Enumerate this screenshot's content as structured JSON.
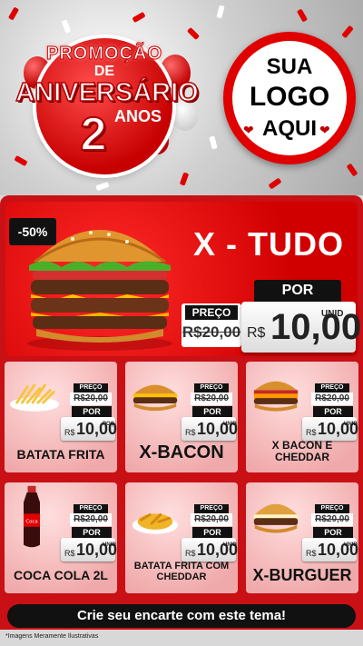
{
  "header": {
    "promo_line1": "PROMOÇÃO",
    "promo_line2": "DE",
    "promo_line3": "ANIVERSÁRIO",
    "promo_number": "2",
    "promo_anos": "ANOS",
    "logo_line1": "SUA",
    "logo_line2": "LOGO",
    "logo_line3": "AQUI"
  },
  "hero": {
    "discount": "-50%",
    "title": "X - TUDO",
    "preco_label": "PREÇO",
    "old_price": "R$20,00",
    "por_label": "POR",
    "currency": "R$",
    "new_price": "10,00",
    "unit": "UNID"
  },
  "products": [
    {
      "name": "BATATA FRITA",
      "preco_label": "PREÇO",
      "old_price": "R$20,00",
      "por_label": "POR",
      "currency": "R$",
      "new_price": "10,00",
      "unit": "POÇ"
    },
    {
      "name": "X-BACON",
      "preco_label": "PREÇO",
      "old_price": "R$20,00",
      "por_label": "POR",
      "currency": "R$",
      "new_price": "10,00",
      "unit": "UNID"
    },
    {
      "name": "X BACON E CHEDDAR",
      "preco_label": "PREÇO",
      "old_price": "R$20,00",
      "por_label": "POR",
      "currency": "R$",
      "new_price": "10,00",
      "unit": "UNID"
    },
    {
      "name": "COCA COLA 2L",
      "preco_label": "PREÇO",
      "old_price": "R$20,00",
      "por_label": "POR",
      "currency": "R$",
      "new_price": "10,00",
      "unit": "UNID"
    },
    {
      "name": "BATATA FRITA COM CHEDDAR",
      "preco_label": "PREÇO",
      "old_price": "R$20,00",
      "por_label": "POR",
      "currency": "R$",
      "new_price": "10,00",
      "unit": "UNID"
    },
    {
      "name": "X-BURGUER",
      "preco_label": "PREÇO",
      "old_price": "R$20,00",
      "por_label": "POR",
      "currency": "R$",
      "new_price": "10,00",
      "unit": "UNID"
    }
  ],
  "footer": {
    "cta": "Crie seu encarte com este tema!",
    "disclaimer": "*Imagens Meramente Ilustrativas"
  },
  "colors": {
    "brand_red": "#c81015",
    "card_pink": "#f0a9aa",
    "tag_black": "#111111"
  }
}
